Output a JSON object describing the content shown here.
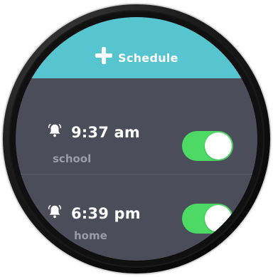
{
  "header": {
    "add_label": "Schedule",
    "add_icon": "plus-icon",
    "color": "#56c5cf"
  },
  "alarms": [
    {
      "time": "9:37 am",
      "label": "school",
      "enabled": true,
      "icon": "bell-icon"
    },
    {
      "time": "6:39 pm",
      "label": "home",
      "enabled": true,
      "icon": "bell-icon"
    }
  ],
  "colors": {
    "background": "#4b4d5a",
    "toggle_on": "#4cd964",
    "label_text": "#9a9ca7"
  }
}
